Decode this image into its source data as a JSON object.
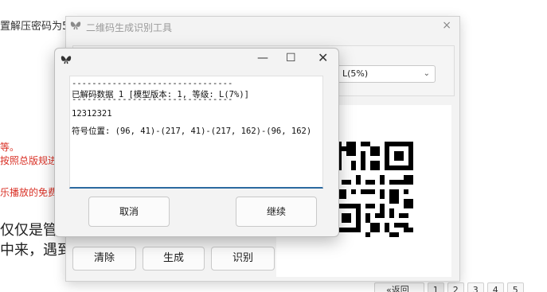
{
  "background": {
    "line1": "置解压密码为5",
    "red1": "等。",
    "red2": "按照总版规进",
    "red3": "乐播放的免费",
    "big1": "仅仅是管",
    "big2": "中来，遇到",
    "pager": {
      "prev": "«返回",
      "pages": [
        "1",
        "2",
        "3",
        "4",
        "5"
      ]
    }
  },
  "main_window": {
    "title": "二维码生成识别工具",
    "close_glyph": "×",
    "error_level": "L(5%)",
    "buttons": {
      "clear": "清除",
      "generate": "生成",
      "recognize": "识别"
    }
  },
  "dialog": {
    "controls": {
      "minimize": "—",
      "maximize": "☐",
      "close": "✕"
    },
    "result_lines": [
      "--------------------------------",
      "已解码数据 1 [模型版本: 1, 等级: L(7%)]",
      "--------------------------------",
      "12312321",
      "",
      "符号位置: (96, 41)-(217, 41)-(217, 162)-(96, 162)"
    ],
    "buttons": {
      "cancel": "取消",
      "continue": "继续"
    }
  },
  "colors": {
    "accent_underline": "#2c6aa0",
    "warning_red": "#d93025"
  },
  "icons": {
    "app_logo": "butterfly-logo-icon"
  }
}
